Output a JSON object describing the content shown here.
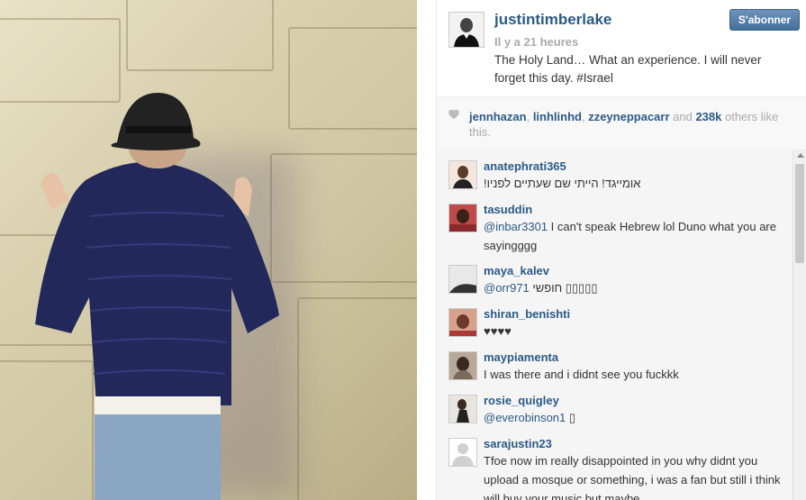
{
  "post": {
    "username": "justintimberlake",
    "time": "Il y a 21 heures",
    "caption": "The Holy Land… What an experience. I will never forget this day. #Israel",
    "follow_label": "S'abonner"
  },
  "likes": {
    "users": [
      "jennhazan",
      "linhlinhd",
      "zzeyneppacarr"
    ],
    "sep1": ", ",
    "sep2": ", ",
    "and": " and ",
    "count": "238k",
    "suffix": " others like this."
  },
  "comments": [
    {
      "user": "anatephrati365",
      "mention": "",
      "text": "אומייגד! הייתי שם שעתיים לפניו!"
    },
    {
      "user": "tasuddin",
      "mention": "@inbar3301",
      "text": " I can't speak Hebrew lol Duno what you are sayingggg"
    },
    {
      "user": "maya_kalev",
      "mention": "@orr971",
      "text": " חופשי ▯▯▯▯▯"
    },
    {
      "user": "shiran_benishti",
      "mention": "",
      "text": "♥♥♥♥"
    },
    {
      "user": "maypiamenta",
      "mention": "",
      "text": "I was there and i didnt see you fuckkk"
    },
    {
      "user": "rosie_quigley",
      "mention": "@everobinson1",
      "text": " ▯"
    },
    {
      "user": "sarajustin23",
      "mention": "",
      "text": "Tfoe now im really disappointed in you why didnt you upload a mosque or something, i was a fan but still i think will buy your music but maybe"
    }
  ],
  "colors": {
    "link": "#2c5a85",
    "follow_bg": "#456f9a"
  },
  "icons": {
    "like": "heart-icon",
    "placeholder_avatar": "default-avatar-icon"
  }
}
